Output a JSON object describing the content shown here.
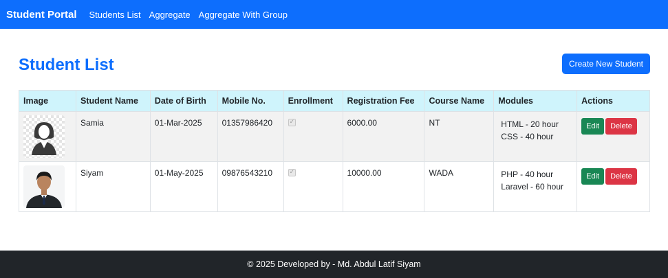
{
  "navbar": {
    "brand": "Student Portal",
    "links": [
      "Students List",
      "Aggregate",
      "Aggregate With Group"
    ]
  },
  "page": {
    "title": "Student List",
    "create_button": "Create New Student"
  },
  "table": {
    "headers": [
      "Image",
      "Student Name",
      "Date of Birth",
      "Mobile No.",
      "Enrollment",
      "Registration Fee",
      "Course Name",
      "Modules",
      "Actions"
    ],
    "rows": [
      {
        "name": "Samia",
        "dob": "01-Mar-2025",
        "mobile": "01357986420",
        "enrolled": true,
        "fee": "6000.00",
        "course": "NT",
        "modules": [
          "HTML - 20 hour",
          "CSS - 40 hour"
        ],
        "edit": "Edit",
        "delete": "Delete"
      },
      {
        "name": "Siyam",
        "dob": "01-May-2025",
        "mobile": "09876543210",
        "enrolled": true,
        "fee": "10000.00",
        "course": "WADA",
        "modules": [
          "PHP - 40 hour",
          "Laravel - 60 hour"
        ],
        "edit": "Edit",
        "delete": "Delete"
      }
    ]
  },
  "footer": {
    "text": "© 2025 Developed by - Md. Abdul Latif Siyam"
  },
  "colors": {
    "primary": "#0d6efd",
    "header_bg": "#cff4fc",
    "edit": "#198754",
    "delete": "#dc3545",
    "footer_bg": "#212529"
  }
}
